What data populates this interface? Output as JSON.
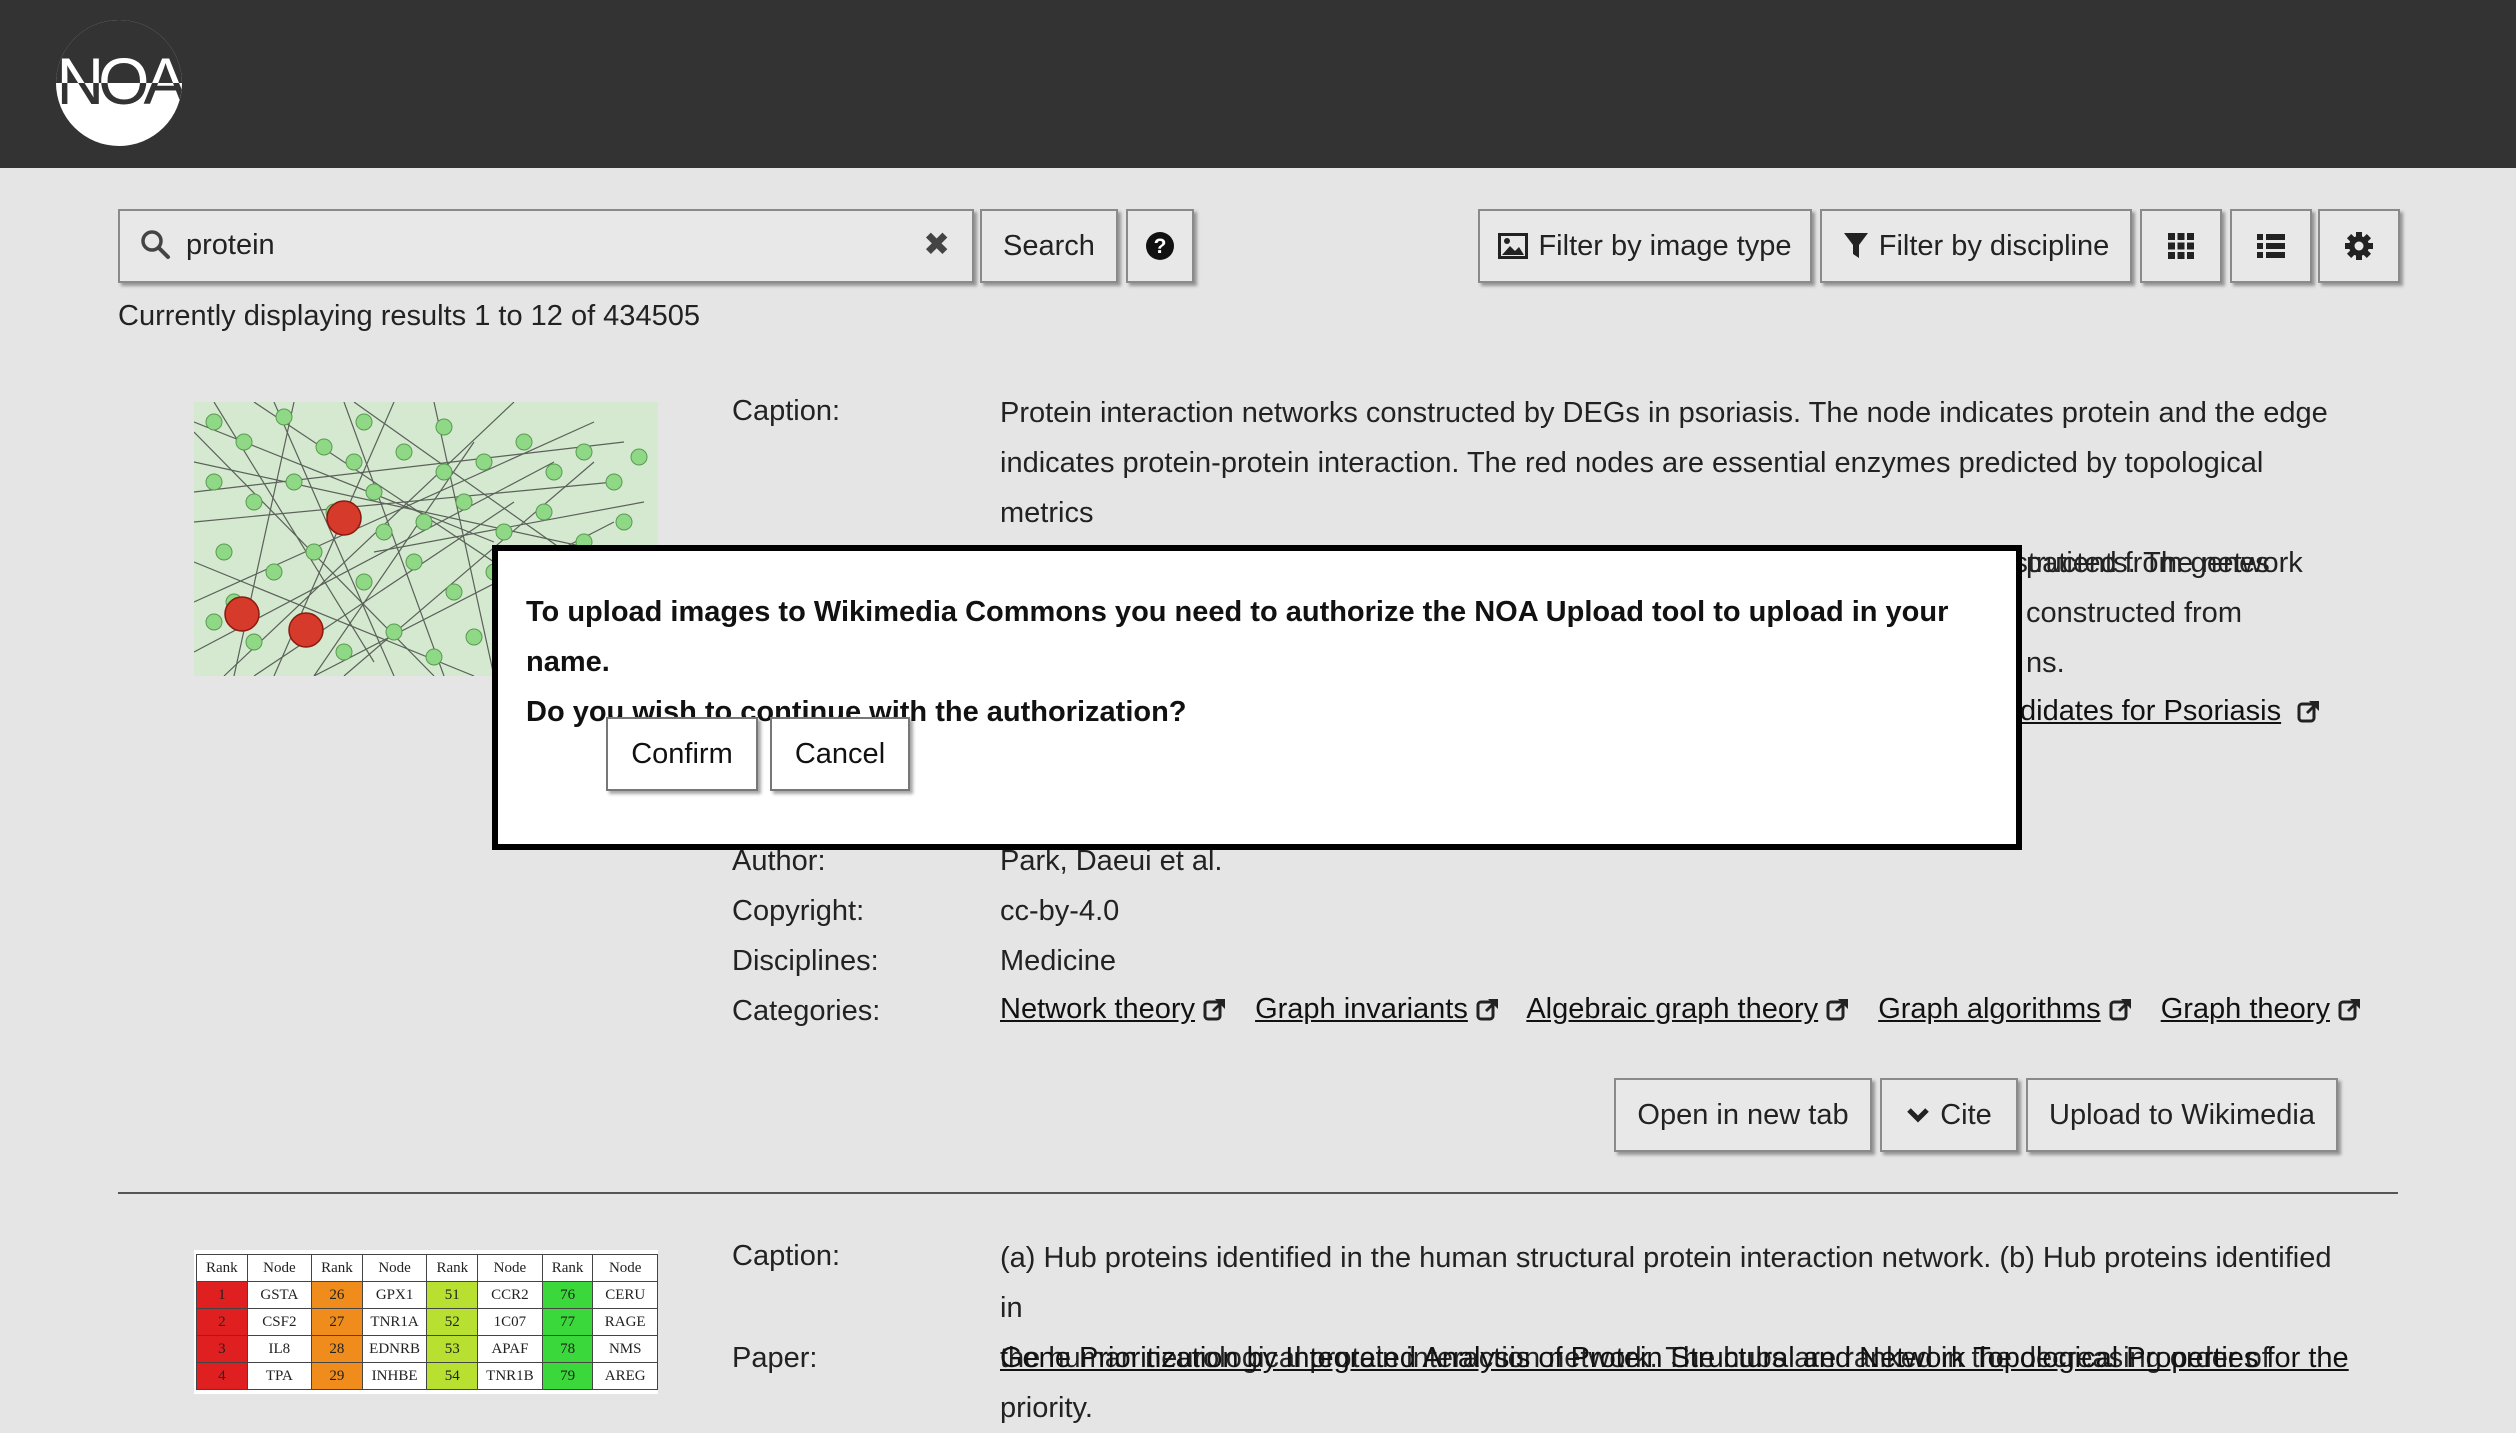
{
  "app": {
    "logo_text": "NOA"
  },
  "search": {
    "value": "protein",
    "button_label": "Search"
  },
  "toolbar": {
    "filter_image_type": "Filter by image type",
    "filter_discipline": "Filter by discipline"
  },
  "results_text": "Currently displaying results 1 to 12 of 434505",
  "result1": {
    "labels": {
      "caption": "Caption:",
      "author": "Author:",
      "copyright": "Copyright:",
      "disciplines": "Disciplines:",
      "categories": "Categories:"
    },
    "caption_lines": [
      "Protein interaction networks constructed by DEGs in psoriasis. The node indicates protein and the edge",
      "indicates protein-protein interaction. The red nodes are essential enzymes predicted by topological metrics",
      "such as degree and betweenness centrality. (a) Protein interaction network constructed from genes",
      "patients. The network",
      "constructed from",
      "ns."
    ],
    "paper_fragment": "didates for Psoriasis",
    "author": "Park, Daeui et al.",
    "copyright": "cc-by-4.0",
    "disciplines": "Medicine",
    "categories": [
      "Network theory",
      "Graph invariants",
      "Algebraic graph theory",
      "Graph algorithms",
      "Graph theory"
    ],
    "actions": {
      "open_tab": "Open in new tab",
      "cite": "Cite",
      "upload": "Upload to Wikimedia"
    }
  },
  "result2": {
    "labels": {
      "caption": "Caption:",
      "paper": "Paper:"
    },
    "caption_lines": [
      "(a) Hub proteins identified in the human structural protein interaction network. (b) Hub proteins identified in",
      "the human neurological protein interaction network. The hubs are ranked in the decreasing order of priority."
    ],
    "paper_title": "Gene Prioritization by Integrated Analysis of Protein Structural and Network Topological Properties for the",
    "table": {
      "headers": [
        "Rank",
        "Node",
        "Rank",
        "Node",
        "Rank",
        "Node",
        "Rank",
        "Node"
      ],
      "rows": [
        [
          "1",
          "GSTA",
          "26",
          "GPX1",
          "51",
          "CCR2",
          "76",
          "CERU"
        ],
        [
          "2",
          "CSF2",
          "27",
          "TNR1A",
          "52",
          "1C07",
          "77",
          "RAGE"
        ],
        [
          "3",
          "IL8",
          "28",
          "EDNRB",
          "53",
          "APAF",
          "78",
          "NMS"
        ],
        [
          "4",
          "TPA",
          "29",
          "INHBE",
          "54",
          "TNR1B",
          "79",
          "AREG"
        ]
      ]
    }
  },
  "modal": {
    "message_line1": "To upload images to Wikimedia Commons you need to authorize the NOA Upload tool to upload in your name.",
    "message_line2": "Do you wish to continue with the authorization?",
    "confirm": "Confirm",
    "cancel": "Cancel"
  },
  "colors": {
    "topbar": "#333333",
    "background": "#e5e5e5",
    "rank_red": "#e02020",
    "rank_orange": "#f08c1c",
    "rank_yellowgreen": "#b8e030",
    "rank_green": "#3ad83a"
  }
}
